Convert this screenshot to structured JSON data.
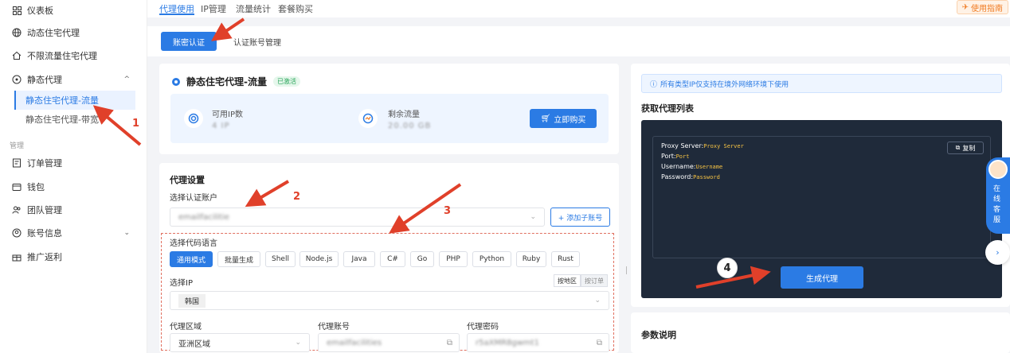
{
  "sidebar": {
    "items": [
      {
        "icon": "dashboard-icon",
        "label": "仪表板"
      },
      {
        "icon": "globe-icon",
        "label": "动态住宅代理"
      },
      {
        "icon": "home-icon",
        "label": "不限流量住宅代理"
      },
      {
        "icon": "location-icon",
        "label": "静态代理",
        "expanded": true
      }
    ],
    "sub_items": [
      {
        "label": "静态住宅代理-流量",
        "active": true
      },
      {
        "label": "静态住宅代理-带宽",
        "active": false
      }
    ],
    "section_label": "管理",
    "manage_items": [
      {
        "icon": "order-icon",
        "label": "订单管理"
      },
      {
        "icon": "wallet-icon",
        "label": "钱包"
      },
      {
        "icon": "team-icon",
        "label": "团队管理"
      },
      {
        "icon": "account-icon",
        "label": "账号信息"
      },
      {
        "icon": "gift-icon",
        "label": "推广返利"
      }
    ]
  },
  "topbar": {
    "tabs": [
      "代理使用",
      "IP管理",
      "流量统计",
      "套餐购买"
    ],
    "guide_label": "使用指南"
  },
  "subtabs": [
    "账密认证",
    "认证账号管理"
  ],
  "proxy_card": {
    "title": "静态住宅代理-流量",
    "status": "已激活",
    "available_ip_label": "可用IP数",
    "available_ip_value": "4 IP",
    "remaining_label": "剩余流量",
    "remaining_value": "20.00 GB",
    "buy_label": "立即购买"
  },
  "settings": {
    "title": "代理设置",
    "auth_account_label": "选择认证账户",
    "auth_account_value": "emailfacilitie",
    "add_sub_label": "+ 添加子账号",
    "lang_label": "选择代码语言",
    "languages": [
      "通用模式",
      "批量生成",
      "Shell",
      "Node.js",
      "Java",
      "C#",
      "Go",
      "PHP",
      "Python",
      "Ruby",
      "Rust"
    ],
    "active_language": "通用模式",
    "ip_label": "选择IP",
    "ip_toggle": [
      "按地区",
      "按订单"
    ],
    "ip_value": "韩国",
    "region_label": "代理区域",
    "region_value": "亚洲区域",
    "account_label": "代理账号",
    "account_value": "emailfacilities",
    "password_label": "代理密码",
    "password_value": "r5aXMR8gwmt1"
  },
  "right_panel": {
    "notice": "所有类型IP仅支持在境外网络环境下使用",
    "list_title": "获取代理列表",
    "copy_label": "复制",
    "code_lines": [
      {
        "key": "Proxy Server:",
        "value": "Proxy Server"
      },
      {
        "key": "Port:",
        "value": "Port"
      },
      {
        "key": "Username:",
        "value": "Username"
      },
      {
        "key": "Password:",
        "value": "Password"
      }
    ],
    "generate_label": "生成代理",
    "param_title": "参数说明"
  },
  "service": {
    "text": "在线客服"
  },
  "annotations": [
    "1",
    "2",
    "3",
    "4"
  ],
  "colors": {
    "accent": "#2b7be4",
    "annotation": "#e0402a",
    "code_bg": "#1f2a3a",
    "value_yellow": "#f6c344"
  }
}
